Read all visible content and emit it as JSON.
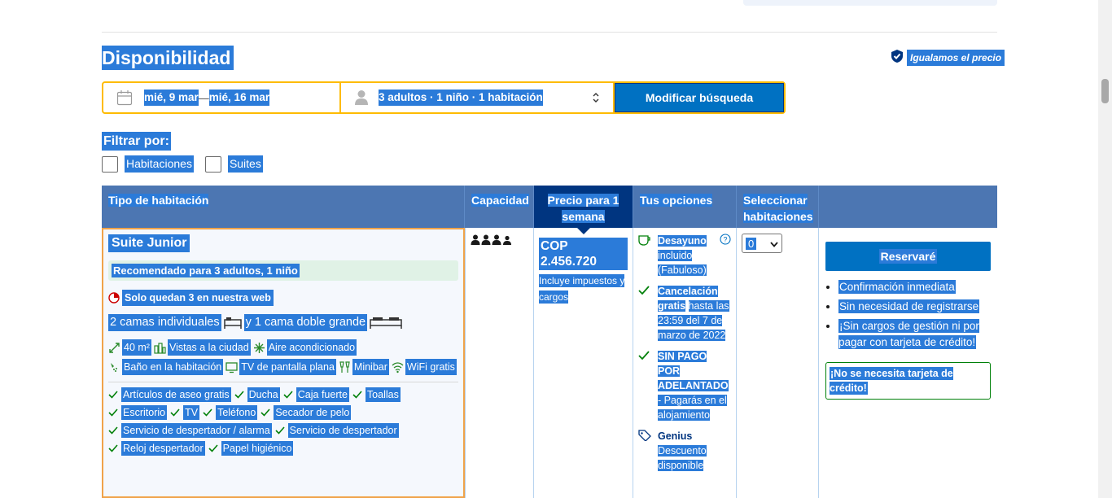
{
  "availability": {
    "title": "Disponibilidad",
    "price_match": "Igualamos el precio"
  },
  "search": {
    "checkin": "mié, 9 mar",
    "separator": "—",
    "checkout": "mié, 16 mar",
    "guests": "3 adultos · 1 niño · 1 habitación",
    "button": "Modificar búsqueda"
  },
  "filters": {
    "label": "Filtrar por:",
    "options": [
      "Habitaciones",
      "Suites"
    ]
  },
  "table": {
    "headers": {
      "room_type": "Tipo de habitación",
      "capacity": "Capacidad",
      "price": "Precio para 1 semana",
      "options": "Tus opciones",
      "select": "Seleccionar habitaciones"
    },
    "room": {
      "name": "Suite Junior",
      "recommended": "Recomendado para 3 adultos, 1 niño",
      "availability": "Solo quedan 3 en nuestra web",
      "beds_a": "2 camas individuales",
      "beds_b": "y 1 cama doble grande",
      "facilities": [
        "40 m²",
        "Vistas a la ciudad",
        "Aire acondicionado",
        "Baño en la habitación",
        "TV de pantalla plana",
        "Minibar",
        "WiFi gratis"
      ],
      "amenities": [
        "Artículos de aseo gratis",
        "Ducha",
        "Caja fuerte",
        "Toallas",
        "Escritorio",
        "TV",
        "Teléfono",
        "Secador de pelo",
        "Servicio de despertador / alarma",
        "Servicio de despertador",
        "Reloj despertador",
        "Papel higiénico"
      ],
      "price": "COP 2.456.720",
      "price_note": "Incluye impuestos y cargos",
      "opt_breakfast_bold": "Desayuno",
      "opt_breakfast_rest": "incluido (Fabuloso)",
      "opt_cancel_bold": "Cancelación gratis",
      "opt_cancel_rest": "hasta las 23:59 del 7 de marzo de 2022",
      "opt_nopay_bold": "SIN PAGO POR ADELANTADO",
      "opt_nopay_rest": "- Pagarás en el alojamiento",
      "opt_genius_bold": "Genius",
      "opt_genius_rest": "Descuento disponible",
      "qty": "0"
    },
    "reserve": {
      "button": "Reservaré",
      "benefits": [
        "Confirmación inmediata",
        "Sin necesidad de registrarse",
        "¡Sin cargos de gestión ni por pagar con tarjeta de crédito!"
      ],
      "no_card": "¡No se necesita tarjeta de crédito!"
    }
  },
  "colors": {
    "primary": "#0071c2",
    "header": "#4c76b2",
    "dark": "#003580",
    "accent": "#febb02",
    "green": "#008009",
    "selection": "#2b7bd9"
  }
}
